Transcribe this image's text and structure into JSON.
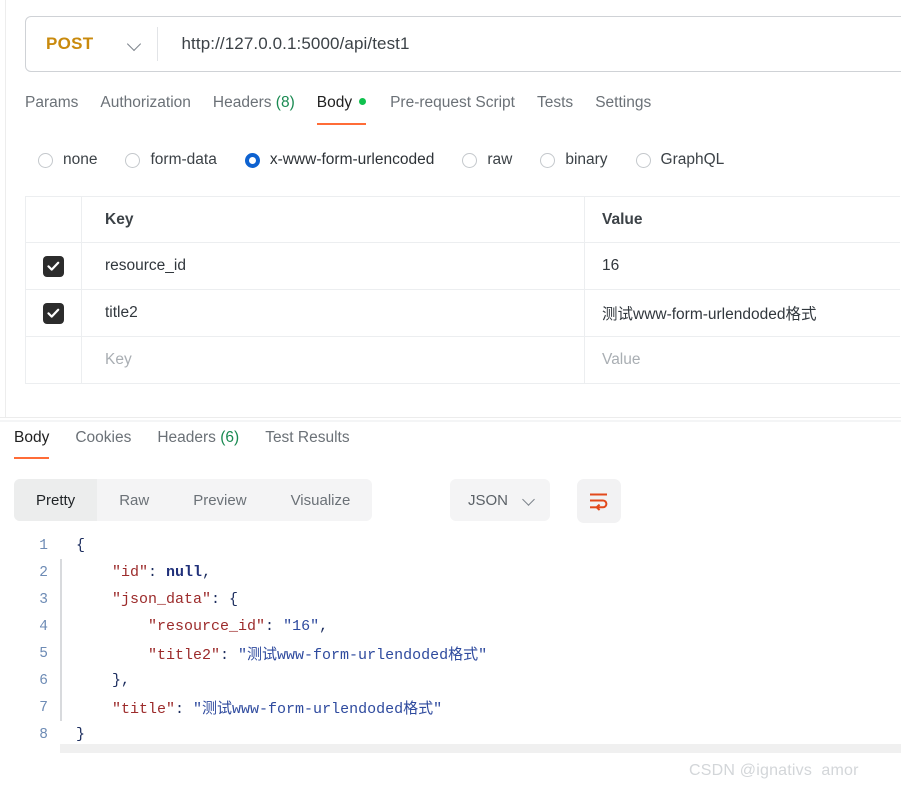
{
  "request": {
    "method": "POST",
    "url": "http://127.0.0.1:5000/api/test1",
    "tabs": [
      {
        "label": "Params",
        "count": "",
        "active": false,
        "dot": false
      },
      {
        "label": "Authorization",
        "count": "",
        "active": false,
        "dot": false
      },
      {
        "label": "Headers",
        "count": "(8)",
        "active": false,
        "dot": false
      },
      {
        "label": "Body",
        "count": "",
        "active": true,
        "dot": true
      },
      {
        "label": "Pre-request Script",
        "count": "",
        "active": false,
        "dot": false
      },
      {
        "label": "Tests",
        "count": "",
        "active": false,
        "dot": false
      },
      {
        "label": "Settings",
        "count": "",
        "active": false,
        "dot": false
      }
    ],
    "body_types": [
      {
        "label": "none",
        "selected": false
      },
      {
        "label": "form-data",
        "selected": false
      },
      {
        "label": "x-www-form-urlencoded",
        "selected": true
      },
      {
        "label": "raw",
        "selected": false
      },
      {
        "label": "binary",
        "selected": false
      },
      {
        "label": "GraphQL",
        "selected": false
      }
    ],
    "table": {
      "headers": {
        "key": "Key",
        "value": "Value"
      },
      "rows": [
        {
          "checked": true,
          "key": "resource_id",
          "value": "16"
        },
        {
          "checked": true,
          "key": "title2",
          "value": "测试www-form-urlendoded格式"
        }
      ],
      "placeholder_row": {
        "key": "Key",
        "value": "Value"
      }
    }
  },
  "response": {
    "tabs": [
      {
        "label": "Body",
        "count": "",
        "active": true
      },
      {
        "label": "Cookies",
        "count": "",
        "active": false
      },
      {
        "label": "Headers",
        "count": "(6)",
        "active": false
      },
      {
        "label": "Test Results",
        "count": "",
        "active": false
      }
    ],
    "formats": [
      {
        "label": "Pretty",
        "active": true
      },
      {
        "label": "Raw",
        "active": false
      },
      {
        "label": "Preview",
        "active": false
      },
      {
        "label": "Visualize",
        "active": false
      }
    ],
    "language": "JSON",
    "wrap_icon": "word-wrap-icon",
    "code_lines": [
      {
        "n": "1",
        "guide": false,
        "tokens": [
          {
            "t": "{",
            "c": "tk-punc"
          }
        ]
      },
      {
        "n": "2",
        "guide": true,
        "tokens": [
          {
            "t": "    ",
            "c": ""
          },
          {
            "t": "\"id\"",
            "c": "tk-key"
          },
          {
            "t": ": ",
            "c": "tk-punc"
          },
          {
            "t": "null",
            "c": "tk-null"
          },
          {
            "t": ",",
            "c": "tk-punc"
          }
        ]
      },
      {
        "n": "3",
        "guide": true,
        "tokens": [
          {
            "t": "    ",
            "c": ""
          },
          {
            "t": "\"json_data\"",
            "c": "tk-key"
          },
          {
            "t": ": {",
            "c": "tk-punc"
          }
        ]
      },
      {
        "n": "4",
        "guide": true,
        "tokens": [
          {
            "t": "        ",
            "c": ""
          },
          {
            "t": "\"resource_id\"",
            "c": "tk-key"
          },
          {
            "t": ": ",
            "c": "tk-punc"
          },
          {
            "t": "\"16\"",
            "c": "tk-str"
          },
          {
            "t": ",",
            "c": "tk-punc"
          }
        ]
      },
      {
        "n": "5",
        "guide": true,
        "tokens": [
          {
            "t": "        ",
            "c": ""
          },
          {
            "t": "\"title2\"",
            "c": "tk-key"
          },
          {
            "t": ": ",
            "c": "tk-punc"
          },
          {
            "t": "\"测试www-form-urlendoded格式\"",
            "c": "tk-str"
          }
        ]
      },
      {
        "n": "6",
        "guide": true,
        "tokens": [
          {
            "t": "    ",
            "c": ""
          },
          {
            "t": "},",
            "c": "tk-punc"
          }
        ]
      },
      {
        "n": "7",
        "guide": true,
        "tokens": [
          {
            "t": "    ",
            "c": ""
          },
          {
            "t": "\"title\"",
            "c": "tk-key"
          },
          {
            "t": ": ",
            "c": "tk-punc"
          },
          {
            "t": "\"测试www-form-urlendoded格式\"",
            "c": "tk-str"
          }
        ]
      },
      {
        "n": "8",
        "guide": false,
        "tokens": [
          {
            "t": "}",
            "c": "tk-punc"
          }
        ]
      }
    ]
  },
  "watermark": "CSDN @ignativs  amor",
  "colors": {
    "accent": "#ff6c37",
    "method": "#c98a0d",
    "radio_selected": "#0e62d0",
    "count_green": "#1a8a52",
    "dot_green": "#10c14e"
  }
}
